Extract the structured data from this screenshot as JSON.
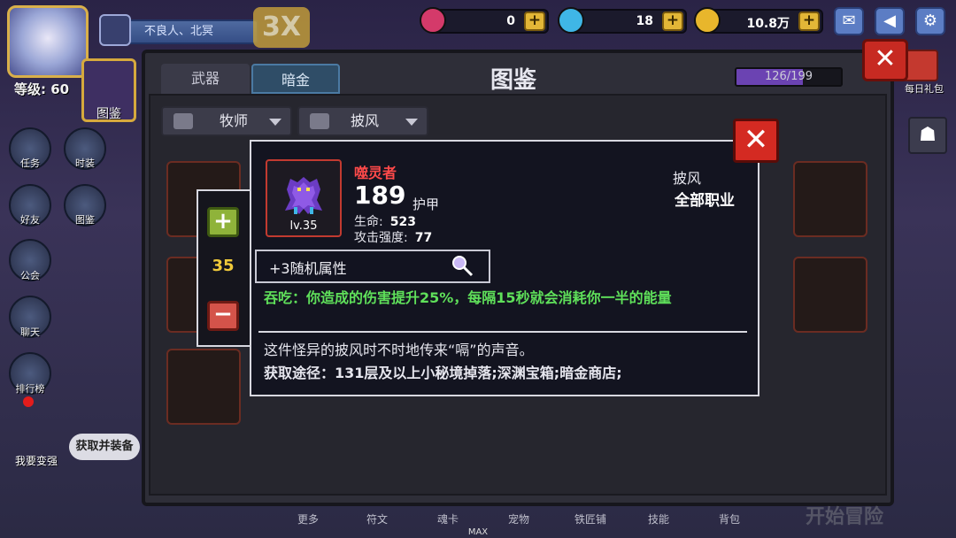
{
  "player": {
    "level_label": "等级: 60",
    "name_plate": "不良人、北冥",
    "bonus": "3X"
  },
  "currencies": [
    {
      "icon": "red-gem-icon",
      "value": "0",
      "color": "#d43a6a"
    },
    {
      "icon": "blue-diamond-icon",
      "value": "18",
      "color": "#3fb6e6"
    },
    {
      "icon": "gold-coin-icon",
      "value": "10.8万",
      "color": "#e8b62c"
    }
  ],
  "top_buttons": [
    "mail-icon",
    "speaker-icon",
    "settings-icon"
  ],
  "left_menu": [
    {
      "name": "task",
      "label": "任务",
      "icon": "scroll-icon"
    },
    {
      "name": "costume",
      "label": "时装",
      "icon": "shirt-icon"
    },
    {
      "name": "friends",
      "label": "好友",
      "icon": "handshake-icon"
    },
    {
      "name": "codex-small",
      "label": "图鉴",
      "icon": "book-icon"
    },
    {
      "name": "guild",
      "label": "公会",
      "icon": "banner-icon"
    },
    {
      "name": "chat",
      "label": "聊天",
      "icon": "chat-bubble-icon"
    },
    {
      "name": "ranking",
      "label": "排行榜",
      "icon": "trophy-icon"
    }
  ],
  "codex_tile_label": "图鉴",
  "grow_label": "我要变强",
  "quest_pill": "获取并装备",
  "daily_gift_label": "每日礼包",
  "panel": {
    "title": "图鉴",
    "tabs": [
      {
        "label": "武器",
        "active": false
      },
      {
        "label": "暗金",
        "active": true
      }
    ],
    "progress_text": "126/199",
    "progress_fraction": 0.633,
    "filter_class": "牧师",
    "filter_slot": "披风"
  },
  "level_adjust": {
    "value": "35",
    "plus": "+",
    "minus": "−"
  },
  "item": {
    "name": "噬灵者",
    "armor_value": "189",
    "armor_label": "护甲",
    "level": "lv.35",
    "hp_label": "生命:",
    "hp_value": "523",
    "atk_label": "攻击强度:",
    "atk_value": "77",
    "slot_type": "披风",
    "class_req": "全部职业",
    "random_attr": "+3随机属性",
    "effect": "吞吃：你造成的伤害提升25%，每隔15秒就会消耗你一半的能量",
    "flavor": "这件怪异的披风时不时地传来“嗝”的声音。",
    "source": "获取途径：131层及以上小秘境掉落;深渊宝箱;暗金商店;",
    "name_color": "#ff4a4a",
    "effect_color": "#5fe05a"
  },
  "bottom_nav": [
    "更多",
    "符文",
    "魂卡",
    "宠物",
    "铁匠铺",
    "技能",
    "背包"
  ],
  "max_label": "MAX",
  "start_adventure": "开始冒险"
}
